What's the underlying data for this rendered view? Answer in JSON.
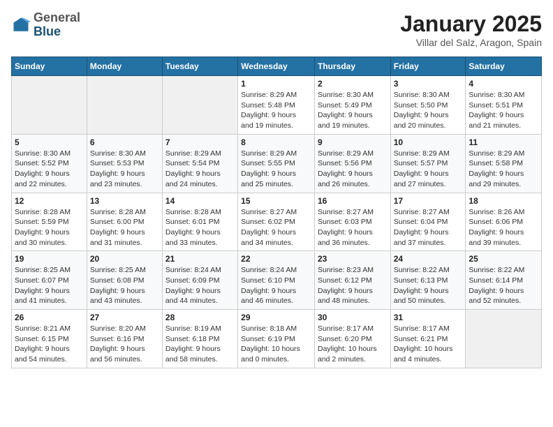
{
  "logo": {
    "general": "General",
    "blue": "Blue"
  },
  "header": {
    "title": "January 2025",
    "subtitle": "Villar del Salz, Aragon, Spain"
  },
  "weekdays": [
    "Sunday",
    "Monday",
    "Tuesday",
    "Wednesday",
    "Thursday",
    "Friday",
    "Saturday"
  ],
  "weeks": [
    [
      {
        "day": "",
        "detail": ""
      },
      {
        "day": "",
        "detail": ""
      },
      {
        "day": "",
        "detail": ""
      },
      {
        "day": "1",
        "detail": "Sunrise: 8:29 AM\nSunset: 5:48 PM\nDaylight: 9 hours\nand 19 minutes."
      },
      {
        "day": "2",
        "detail": "Sunrise: 8:30 AM\nSunset: 5:49 PM\nDaylight: 9 hours\nand 19 minutes."
      },
      {
        "day": "3",
        "detail": "Sunrise: 8:30 AM\nSunset: 5:50 PM\nDaylight: 9 hours\nand 20 minutes."
      },
      {
        "day": "4",
        "detail": "Sunrise: 8:30 AM\nSunset: 5:51 PM\nDaylight: 9 hours\nand 21 minutes."
      }
    ],
    [
      {
        "day": "5",
        "detail": "Sunrise: 8:30 AM\nSunset: 5:52 PM\nDaylight: 9 hours\nand 22 minutes."
      },
      {
        "day": "6",
        "detail": "Sunrise: 8:30 AM\nSunset: 5:53 PM\nDaylight: 9 hours\nand 23 minutes."
      },
      {
        "day": "7",
        "detail": "Sunrise: 8:29 AM\nSunset: 5:54 PM\nDaylight: 9 hours\nand 24 minutes."
      },
      {
        "day": "8",
        "detail": "Sunrise: 8:29 AM\nSunset: 5:55 PM\nDaylight: 9 hours\nand 25 minutes."
      },
      {
        "day": "9",
        "detail": "Sunrise: 8:29 AM\nSunset: 5:56 PM\nDaylight: 9 hours\nand 26 minutes."
      },
      {
        "day": "10",
        "detail": "Sunrise: 8:29 AM\nSunset: 5:57 PM\nDaylight: 9 hours\nand 27 minutes."
      },
      {
        "day": "11",
        "detail": "Sunrise: 8:29 AM\nSunset: 5:58 PM\nDaylight: 9 hours\nand 29 minutes."
      }
    ],
    [
      {
        "day": "12",
        "detail": "Sunrise: 8:28 AM\nSunset: 5:59 PM\nDaylight: 9 hours\nand 30 minutes."
      },
      {
        "day": "13",
        "detail": "Sunrise: 8:28 AM\nSunset: 6:00 PM\nDaylight: 9 hours\nand 31 minutes."
      },
      {
        "day": "14",
        "detail": "Sunrise: 8:28 AM\nSunset: 6:01 PM\nDaylight: 9 hours\nand 33 minutes."
      },
      {
        "day": "15",
        "detail": "Sunrise: 8:27 AM\nSunset: 6:02 PM\nDaylight: 9 hours\nand 34 minutes."
      },
      {
        "day": "16",
        "detail": "Sunrise: 8:27 AM\nSunset: 6:03 PM\nDaylight: 9 hours\nand 36 minutes."
      },
      {
        "day": "17",
        "detail": "Sunrise: 8:27 AM\nSunset: 6:04 PM\nDaylight: 9 hours\nand 37 minutes."
      },
      {
        "day": "18",
        "detail": "Sunrise: 8:26 AM\nSunset: 6:06 PM\nDaylight: 9 hours\nand 39 minutes."
      }
    ],
    [
      {
        "day": "19",
        "detail": "Sunrise: 8:25 AM\nSunset: 6:07 PM\nDaylight: 9 hours\nand 41 minutes."
      },
      {
        "day": "20",
        "detail": "Sunrise: 8:25 AM\nSunset: 6:08 PM\nDaylight: 9 hours\nand 43 minutes."
      },
      {
        "day": "21",
        "detail": "Sunrise: 8:24 AM\nSunset: 6:09 PM\nDaylight: 9 hours\nand 44 minutes."
      },
      {
        "day": "22",
        "detail": "Sunrise: 8:24 AM\nSunset: 6:10 PM\nDaylight: 9 hours\nand 46 minutes."
      },
      {
        "day": "23",
        "detail": "Sunrise: 8:23 AM\nSunset: 6:12 PM\nDaylight: 9 hours\nand 48 minutes."
      },
      {
        "day": "24",
        "detail": "Sunrise: 8:22 AM\nSunset: 6:13 PM\nDaylight: 9 hours\nand 50 minutes."
      },
      {
        "day": "25",
        "detail": "Sunrise: 8:22 AM\nSunset: 6:14 PM\nDaylight: 9 hours\nand 52 minutes."
      }
    ],
    [
      {
        "day": "26",
        "detail": "Sunrise: 8:21 AM\nSunset: 6:15 PM\nDaylight: 9 hours\nand 54 minutes."
      },
      {
        "day": "27",
        "detail": "Sunrise: 8:20 AM\nSunset: 6:16 PM\nDaylight: 9 hours\nand 56 minutes."
      },
      {
        "day": "28",
        "detail": "Sunrise: 8:19 AM\nSunset: 6:18 PM\nDaylight: 9 hours\nand 58 minutes."
      },
      {
        "day": "29",
        "detail": "Sunrise: 8:18 AM\nSunset: 6:19 PM\nDaylight: 10 hours\nand 0 minutes."
      },
      {
        "day": "30",
        "detail": "Sunrise: 8:17 AM\nSunset: 6:20 PM\nDaylight: 10 hours\nand 2 minutes."
      },
      {
        "day": "31",
        "detail": "Sunrise: 8:17 AM\nSunset: 6:21 PM\nDaylight: 10 hours\nand 4 minutes."
      },
      {
        "day": "",
        "detail": ""
      }
    ]
  ]
}
